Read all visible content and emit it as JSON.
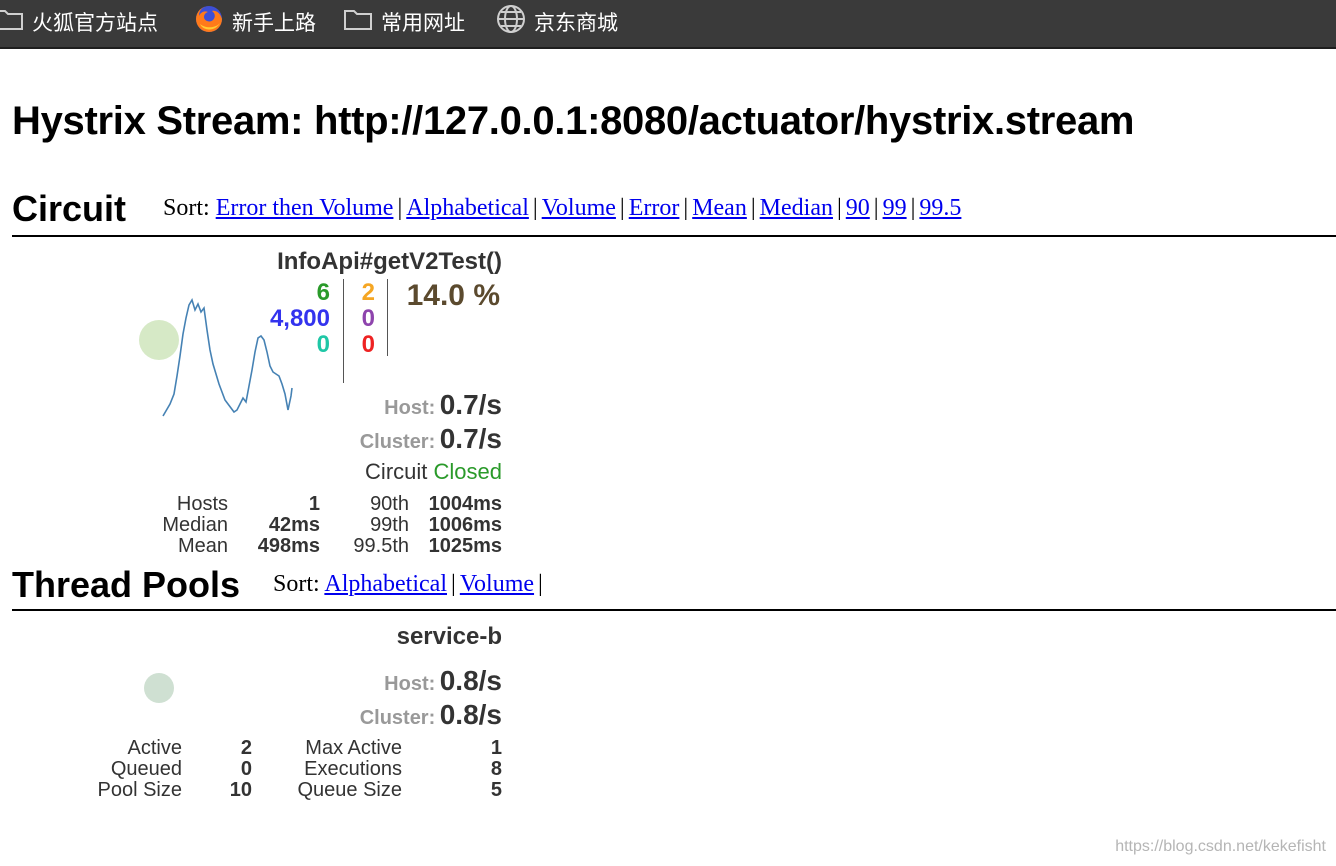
{
  "bookmarks": [
    {
      "label": "火狐官方站点",
      "icon": "folder-icon"
    },
    {
      "label": "新手上路",
      "icon": "firefox-icon"
    },
    {
      "label": "常用网址",
      "icon": "folder-icon"
    },
    {
      "label": "京东商城",
      "icon": "globe-icon"
    }
  ],
  "page_title": "Hystrix Stream: http://127.0.0.1:8080/actuator/hystrix.stream",
  "circuit": {
    "title": "Circuit",
    "sort_label": "Sort:",
    "sort_links": [
      "Error then Volume",
      "Alphabetical",
      "Volume",
      "Error",
      "Mean",
      "Median",
      "90",
      "99",
      "99.5"
    ],
    "card": {
      "name": "InfoApi#getV2Test()",
      "success": "6",
      "short_circuited": "4,800",
      "bad_request": "0",
      "timeout": "2",
      "rejected": "0",
      "failure": "0",
      "error_percent": "14.0 %",
      "host_label": "Host:",
      "host_rate": "0.7/s",
      "cluster_label": "Cluster:",
      "cluster_rate": "0.7/s",
      "circuit_label": "Circuit",
      "circuit_status": "Closed",
      "stats": {
        "hosts_label": "Hosts",
        "hosts": "1",
        "median_label": "Median",
        "median": "42ms",
        "mean_label": "Mean",
        "mean": "498ms",
        "p90_label": "90th",
        "p90": "1004ms",
        "p99_label": "99th",
        "p99": "1006ms",
        "p995_label": "99.5th",
        "p995": "1025ms"
      }
    }
  },
  "thread_pools": {
    "title": "Thread Pools",
    "sort_label": "Sort:",
    "sort_links": [
      "Alphabetical",
      "Volume"
    ],
    "card": {
      "name": "service-b",
      "host_label": "Host:",
      "host_rate": "0.8/s",
      "cluster_label": "Cluster:",
      "cluster_rate": "0.8/s",
      "stats": {
        "active_label": "Active",
        "active": "2",
        "queued_label": "Queued",
        "queued": "0",
        "pool_size_label": "Pool Size",
        "pool_size": "10",
        "max_active_label": "Max Active",
        "max_active": "1",
        "executions_label": "Executions",
        "executions": "8",
        "queue_size_label": "Queue Size",
        "queue_size": "5"
      }
    }
  },
  "watermark": "https://blog.csdn.net/kekefisht",
  "colors": {
    "success": "#2a9a2a",
    "short_circuited": "#3333ee",
    "bad_request": "#1fc7a6",
    "timeout": "#f5a623",
    "rejected": "#8e44ad",
    "failure": "#ee2222",
    "error_percent": "#5b4a2e",
    "closed": "#2a9a2a",
    "link": "#0000ee"
  }
}
